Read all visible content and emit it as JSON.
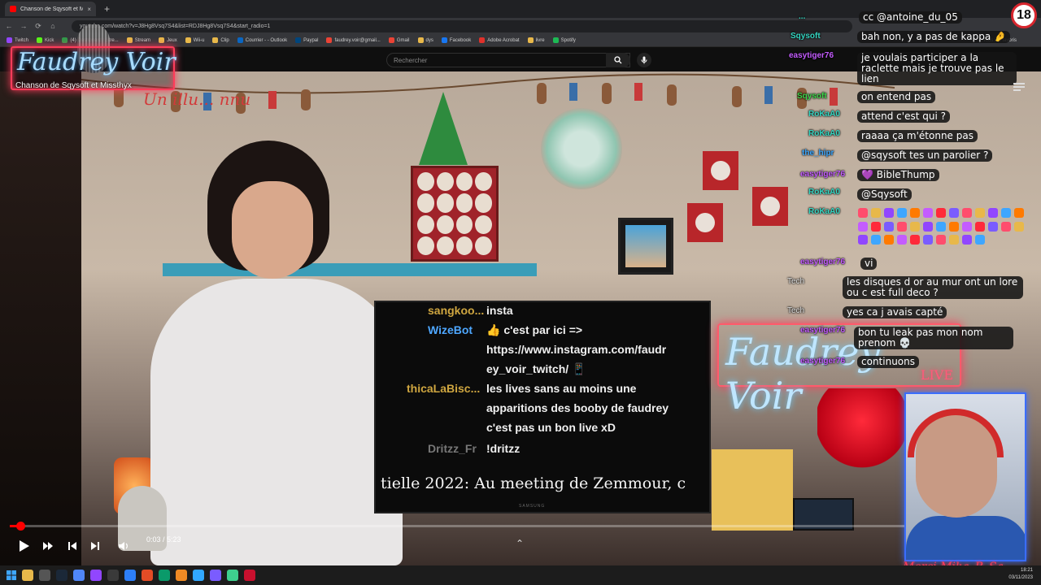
{
  "browser": {
    "tab_title": "Chanson de Sqysoft et Missthyx",
    "tab_close": "×",
    "new_tab": "+",
    "url": "youtube.com/watch?v=J8Hg8Vsq7S4&list=RDJ8Hg8Vsq7S4&start_radio=1",
    "bookmarks": [
      "Twitch",
      "Kick",
      "(4) Dashboard / Stre...",
      "Stream",
      "Jeux",
      "Wii-u",
      "Clip",
      "Courrier - - Outlook",
      "Paypal",
      "faudrey.voir@gmail...",
      "Gmail",
      "dys",
      "Facebook",
      "Adobe Acrobat",
      "livre",
      "Spotify"
    ],
    "all_bookmarks": "Tous les favoris"
  },
  "youtube": {
    "search_placeholder": "Rechercher"
  },
  "overlay": {
    "logo_text": "Faudrey Voir",
    "logo_subtitle": "Chanson de Sqysoft et Missthyx",
    "sign_text": "Un illu... nnu",
    "badge": "18",
    "webcam_sign": "Merci Mika_B_Sa"
  },
  "tv_chat": {
    "rows": [
      {
        "user": "sangkoo...",
        "text": "insta"
      },
      {
        "user": "WizeBot",
        "text": "👍 c'est par ici =>"
      },
      {
        "user": "",
        "text": "https://www.instagram.com/faudr"
      },
      {
        "user": "",
        "text": "ey_voir_twitch/ 📱"
      },
      {
        "user": "thicaLaBisc...",
        "text": "les lives sans au moins une"
      },
      {
        "user": "",
        "text": "apparitions des booby de faudrey"
      },
      {
        "user": "",
        "text": "c'est pas un bon live xD"
      },
      {
        "user": "Dritzz_Fr",
        "text": "!dritzz"
      }
    ],
    "caption": "tielle 2022: Au meeting de Zemmour, c",
    "brand": "SAMSUNG"
  },
  "chat": {
    "messages": [
      {
        "user": "...",
        "text": "cc @antoine_du_05"
      },
      {
        "user": "Sqysoft",
        "text": "bah non, y a pas de kappa 🤌"
      },
      {
        "user": "easytiger76",
        "text": "je voulais participer a la raclette mais je trouve pas le lien"
      },
      {
        "user": "Sqysoft",
        "text": "on entend pas"
      },
      {
        "user": "RoKaA0",
        "text": "attend c'est qui ?"
      },
      {
        "user": "RoKaA0",
        "text": "raaaa ça m'étonne pas"
      },
      {
        "user": "the_hipr",
        "text": "@sqysoft tes un parolier ?"
      },
      {
        "user": "easytiger76",
        "text": "💜 BibleThump"
      },
      {
        "user": "RoKaA0",
        "text": "@Sqysoft"
      },
      {
        "user": "RoKaA0",
        "text": ""
      },
      {
        "user": "easytiger76",
        "text": "vi"
      },
      {
        "user": "Tech",
        "text": "les disques d or au mur ont un lore ou c est full deco ?"
      },
      {
        "user": "Tech",
        "text": "yes ca j avais capté"
      },
      {
        "user": "easytiger76",
        "text": "bon tu leak pas mon nom prenom 💀"
      },
      {
        "user": "easytiger76",
        "text": "continuons"
      }
    ]
  },
  "player": {
    "time": "0:03 / 5:23",
    "progress_fraction": 0.012
  },
  "taskbar": {
    "clock_time": "18:21",
    "clock_date": "03/11/2023"
  },
  "colors": {
    "neon_pink": "#ff3c5a",
    "neon_blue": "#a8dcff",
    "yt_red": "#ff0000",
    "chat_user_teal": "#2ef0d0",
    "chat_user_purple": "#c45cff"
  }
}
